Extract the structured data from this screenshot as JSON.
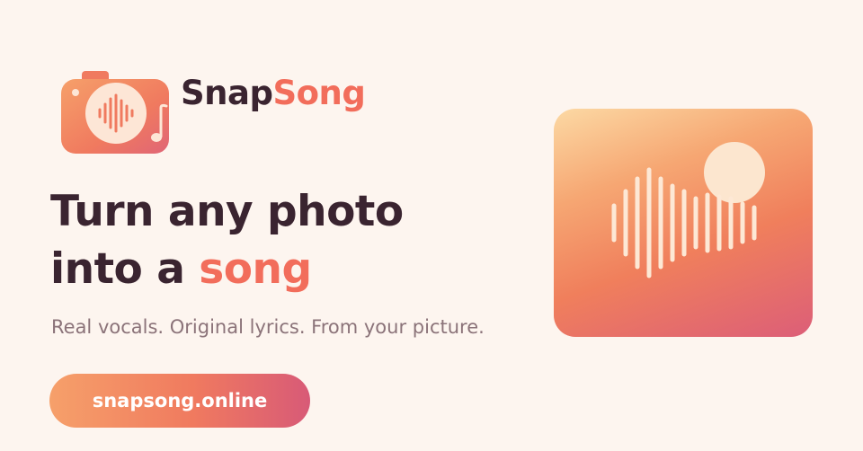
{
  "brand": {
    "name_part1": "Snap",
    "name_part2": "Song"
  },
  "headline": {
    "line1": "Turn any photo",
    "line2_prefix": "into a ",
    "line2_accent": "song"
  },
  "tagline": "Real vocals. Original lyrics. From your picture.",
  "cta": {
    "label": "snapsong.online"
  },
  "colors": {
    "background": "#fdf5ef",
    "dark_text": "#3a2430",
    "accent": "#f26d5b",
    "muted_text": "#8b7379"
  },
  "icons": {
    "logo": "camera-soundwave-music-note-icon",
    "art": "soundwave-sun-icon"
  }
}
